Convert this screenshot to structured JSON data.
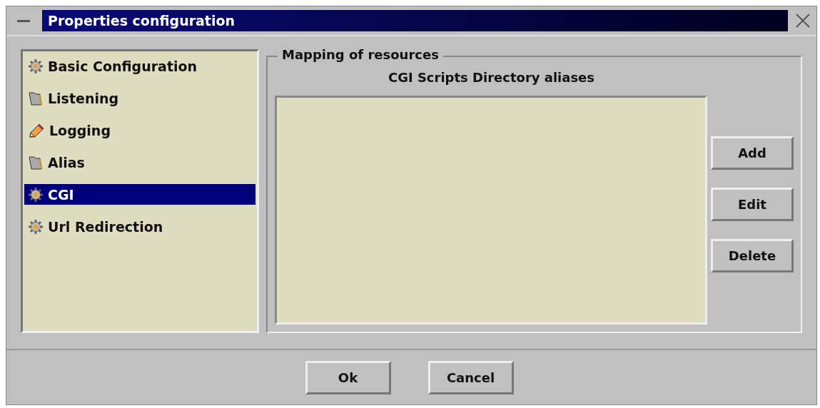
{
  "window": {
    "title": "Properties configuration"
  },
  "sidebar": {
    "items": [
      {
        "label": "Basic Configuration",
        "kind": "gear",
        "selected": false
      },
      {
        "label": "Listening",
        "kind": "folder",
        "selected": false
      },
      {
        "label": "Logging",
        "kind": "pencil",
        "selected": false
      },
      {
        "label": "Alias",
        "kind": "folder",
        "selected": false
      },
      {
        "label": "CGI",
        "kind": "gear",
        "selected": true
      },
      {
        "label": "Url Redirection",
        "kind": "gear",
        "selected": false
      }
    ]
  },
  "group": {
    "title": "Mapping of resources",
    "list_title": "CGI Scripts Directory aliases",
    "buttons": [
      "Add",
      "Edit",
      "Delete"
    ]
  },
  "buttons": [
    "Ok",
    "Cancel"
  ]
}
